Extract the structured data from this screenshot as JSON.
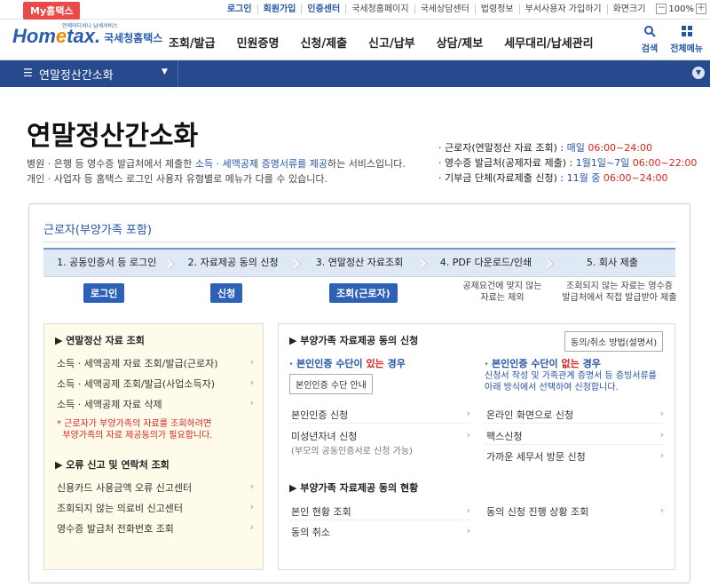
{
  "top": {
    "mytax": "My홈택스",
    "links": [
      "로그인",
      "회원가입",
      "인증센터",
      "국세청홈페이지",
      "국세상담센터",
      "법령정보",
      "부서사용자 가입하기",
      "화면크기"
    ],
    "zoom_minus": "－",
    "zoom_value": "100%",
    "zoom_plus": "＋"
  },
  "header": {
    "logo_home": "Hom",
    "logo_e": "e",
    "logo_tax": "tax.",
    "logo_sub": "국세청홈택스",
    "logo_tiny": "언제어디서나 납세서비스",
    "nav": [
      "조회/발급",
      "민원증명",
      "신청/제출",
      "신고/납부",
      "상담/제보",
      "세무대리/납세관리"
    ],
    "search_label": "검색",
    "menu_label": "전체메뉴"
  },
  "bluebar": {
    "title": "연말정산간소화",
    "menu_icon": "☰",
    "dd_icon": "▼"
  },
  "page": {
    "title": "연말정산간소화",
    "desc1_a": "병원 · 은행 등 영수증 발급처에서 제출한 ",
    "desc1_hl": "소득 · 세액공제 증명서류를 제공",
    "desc1_b": "하는 서비스입니다.",
    "desc2": "개인 · 사업자 등 홈택스 로그인 사용자 유형별로 메뉴가 다를 수 있습니다.",
    "times": [
      {
        "label": "근로자(연말정산 자료 조회) : ",
        "pre": "매일 ",
        "time": "06:00~24:00"
      },
      {
        "label": "영수증 발급처(공제자료 제출) : ",
        "pre": "1월1일~7일 ",
        "time": "06:00~22:00"
      },
      {
        "label": "기부금 단체(자료제출 신청) : ",
        "pre": "11월 중 ",
        "time": "06:00~24:00"
      }
    ]
  },
  "panel": {
    "title": "근로자(부양가족 포함)",
    "steps": [
      "1. 공동인증서 등 로그인",
      "2. 자료제공 동의 신청",
      "3. 연말정산 자료조회",
      "4. PDF 다운로드/인쇄",
      "5. 회사 제출"
    ],
    "btn_login": "로그인",
    "btn_apply": "신청",
    "btn_query": "조회(근로자)",
    "note4": "공제요건에 맞지 않는\n자료는 제외",
    "note5": "조회되지 않는 자료는 영수증\n발급처에서 직접 발급받아 제출"
  },
  "left": {
    "h1": "▶ 연말정산 자료 조회",
    "items1": [
      "소득 · 세액공제 자료 조회/발급(근로자)",
      "소득 · 세액공제 조회/발급(사업소득자)",
      "소득 · 세액공제 자료 삭제"
    ],
    "red1": "* 근로자가 부양가족의 자료를 조회하려면",
    "red2": "  부양가족의 자료 제공동의가 필요합니다.",
    "h2": "▶ 오류 신고 및 연락처 조회",
    "items2": [
      "신용카드 사용금액 오류 신고센터",
      "조회되지 않는 의료비 신고센터",
      "영수증 발급처 전화번호 조회"
    ]
  },
  "right": {
    "h1": "▶ 부양가족 자료제공 동의 신청",
    "howto": "동의/취소 방법(설명서)",
    "has_a": "· 본인인증 수단이 ",
    "has_b": "있는",
    "has_c": " 경우",
    "none_a": "· 본인인증 수단이 ",
    "none_b": "없는",
    "none_c": " 경우",
    "auth_btn": "본인인증 수단 안내",
    "none_note": "신청서 작성 및 가족관계 증명서 등 증빙서류를\n아래 방식에서 선택하여 신청합니다.",
    "apply_items": [
      "본인인증 신청",
      "미성년자녀 신청"
    ],
    "minor_sub": "(부모의 공동인증서로 신청 가능)",
    "none_items": [
      "온라인 화면으로 신청",
      "팩스신청",
      "가까운 세무서 방문 신청"
    ],
    "h2": "▶ 부양가족 자료제공 동의 현황",
    "status_left": [
      "본인 현황 조회",
      "동의 취소"
    ],
    "status_right": [
      "동의 신청 진행 상황 조회"
    ]
  }
}
